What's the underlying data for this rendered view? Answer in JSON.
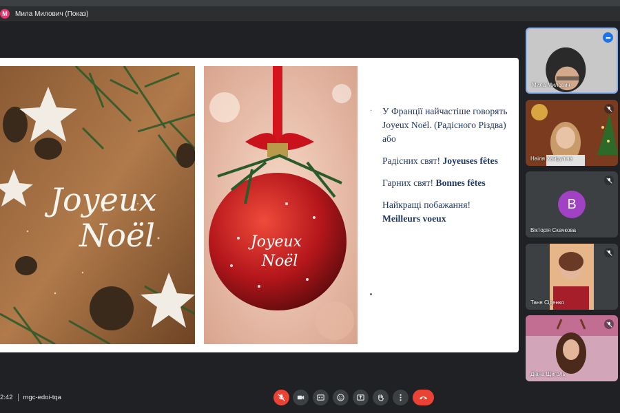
{
  "presenter": {
    "avatar_letter": "М",
    "label": "Мила Милович (Показ)"
  },
  "slide": {
    "left_image_text": [
      "Joyeux",
      "Noël"
    ],
    "right_image_text": [
      "Joyeux",
      "Noël"
    ],
    "paragraphs": [
      {
        "plain": "У Франції найчастіше говорять Joyeux Noël. (Радісного Різдва) або",
        "bold": ""
      },
      {
        "plain": "Радісних свят! ",
        "bold": "Joyeuses fêtes"
      },
      {
        "plain": "Гарних свят! ",
        "bold": "Bonnes fêtes"
      },
      {
        "plain": "Найкращі побажання! ",
        "bold": "Meilleurs voeux"
      }
    ]
  },
  "participants": [
    {
      "name": "Мила Милович",
      "muted": false,
      "menu": "•••"
    },
    {
      "name": "Наіля Хайруліна",
      "muted": true
    },
    {
      "name": "Вікторія Скачкова",
      "muted": true,
      "avatar_letter": "B"
    },
    {
      "name": "Таня Сіденко",
      "muted": true
    },
    {
      "name": "Діана Щиголь",
      "muted": true
    }
  ],
  "meeting": {
    "time": "2:42",
    "code": "mgc-edoi-tqa"
  },
  "controls": [
    "mic-off",
    "camera",
    "captions",
    "emoji",
    "present",
    "raise-hand",
    "more",
    "leave-call"
  ],
  "colors": {
    "background": "#202124",
    "accent": "#1a73e8",
    "danger": "#ea4335",
    "slide_text": "#1f3864",
    "avatar": "#a142c4"
  }
}
